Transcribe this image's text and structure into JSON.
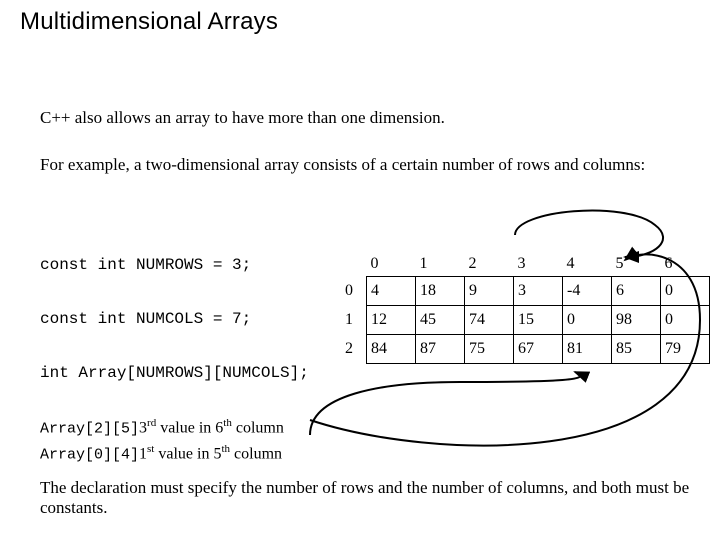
{
  "title": "Multidimensional Arrays",
  "para1": "C++ also allows an array to have more than one dimension.",
  "para2": "For example, a two-dimensional array consists of a certain number of rows and columns:",
  "code_lines": [
    "const int NUMROWS = 3;",
    "const int NUMCOLS = 7;",
    "int Array[NUMROWS][NUMCOLS];"
  ],
  "table": {
    "col_headers": [
      "0",
      "1",
      "2",
      "3",
      "4",
      "5",
      "6"
    ],
    "row_headers": [
      "0",
      "1",
      "2"
    ],
    "cells": [
      [
        "4",
        "18",
        "9",
        "3",
        "-4",
        "6",
        "0"
      ],
      [
        "12",
        "45",
        "74",
        "15",
        "0",
        "98",
        "0"
      ],
      [
        "84",
        "87",
        "75",
        "67",
        "81",
        "85",
        "79"
      ]
    ]
  },
  "ref1_code": "Array[2][5]",
  "ref1_a": "3",
  "ref1_b": "rd value in 6",
  "ref1_c": "th column",
  "ref2_code": "Array[0][4]",
  "ref2_a": "1",
  "ref2_b": "st value in 5",
  "ref2_c": "th column",
  "para3": "The declaration must specify the number of rows and the number of columns, and both must be constants."
}
